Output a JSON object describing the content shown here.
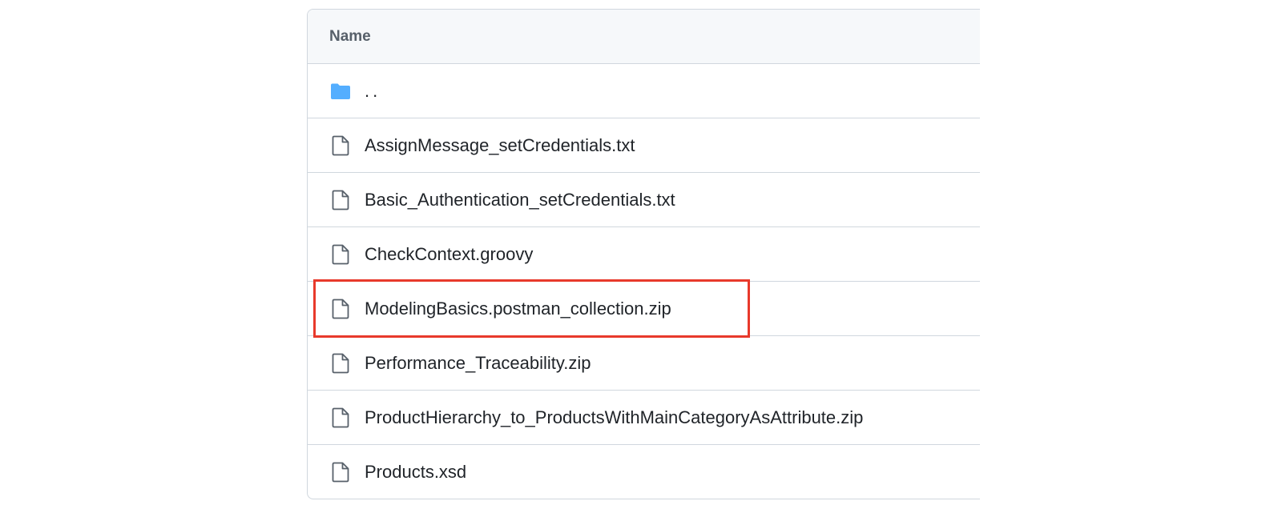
{
  "table": {
    "header_label": "Name",
    "rows": [
      {
        "label": "..",
        "icon": "folder-icon"
      },
      {
        "label": "AssignMessage_setCredentials.txt",
        "icon": "file-icon"
      },
      {
        "label": "Basic_Authentication_setCredentials.txt",
        "icon": "file-icon"
      },
      {
        "label": "CheckContext.groovy",
        "icon": "file-icon"
      },
      {
        "label": "ModelingBasics.postman_collection.zip",
        "icon": "file-icon"
      },
      {
        "label": "Performance_Traceability.zip",
        "icon": "file-icon"
      },
      {
        "label": "ProductHierarchy_to_ProductsWithMainCategoryAsAttribute.zip",
        "icon": "file-icon"
      },
      {
        "label": "Products.xsd",
        "icon": "file-icon"
      }
    ]
  },
  "highlight": {
    "target_row": 4,
    "color": "#e8392b"
  },
  "colors": {
    "folder": "#54aeff",
    "file_icon": "#57606a",
    "border": "#d0d7de",
    "header_bg": "#f6f8fa"
  }
}
